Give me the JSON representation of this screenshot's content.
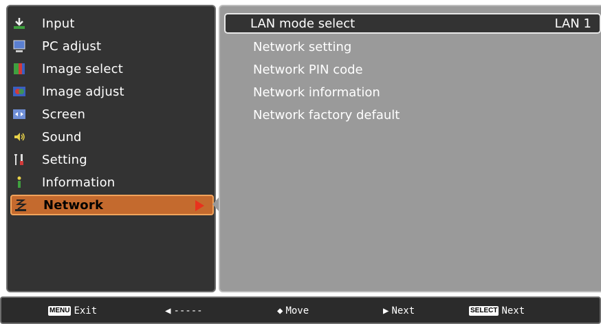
{
  "menu": {
    "items": [
      {
        "label": "Input",
        "icon": "input-icon"
      },
      {
        "label": "PC adjust",
        "icon": "pc-adjust-icon"
      },
      {
        "label": "Image select",
        "icon": "image-select-icon"
      },
      {
        "label": "Image adjust",
        "icon": "image-adjust-icon"
      },
      {
        "label": "Screen",
        "icon": "screen-icon"
      },
      {
        "label": "Sound",
        "icon": "sound-icon"
      },
      {
        "label": "Setting",
        "icon": "setting-icon"
      },
      {
        "label": "Information",
        "icon": "information-icon"
      },
      {
        "label": "Network",
        "icon": "network-icon"
      }
    ],
    "selected": "Network"
  },
  "submenu": {
    "items": [
      {
        "label": "LAN mode select",
        "value": "LAN 1"
      },
      {
        "label": "Network setting"
      },
      {
        "label": "Network PIN code"
      },
      {
        "label": "Network information"
      },
      {
        "label": "Network factory default"
      }
    ],
    "highlighted": "LAN mode select"
  },
  "help": {
    "menu_key": "MENU",
    "exit": "Exit",
    "back_arrow": "◀",
    "back_text": "-----",
    "move_glyph": "◆",
    "move": "Move",
    "next_glyph": "▶",
    "next": "Next",
    "select_key": "SELECT",
    "select_next": "Next"
  },
  "colors": {
    "menu_bg": "#333333",
    "selected_bg": "#c46a2e",
    "submenu_bg": "#9a9a9a",
    "arrow": "#e8321d"
  }
}
